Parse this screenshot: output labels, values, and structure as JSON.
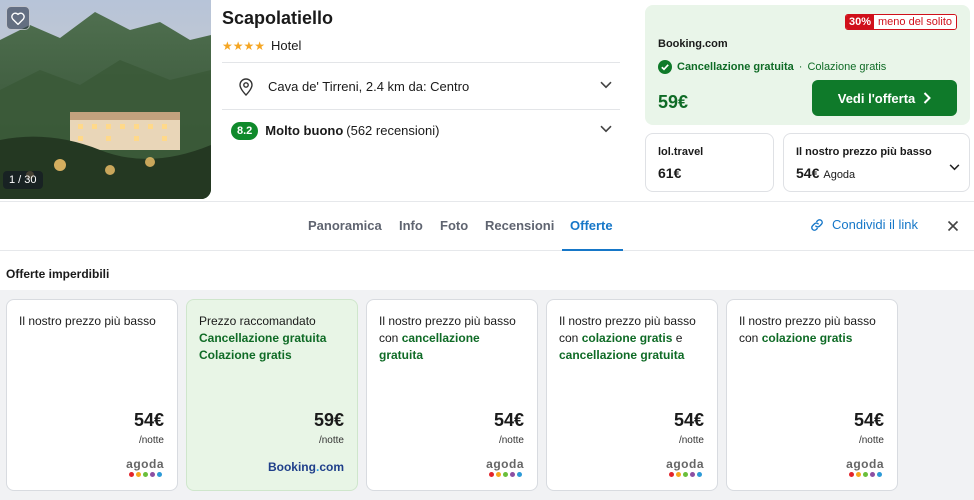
{
  "hotel": {
    "name": "Scapolatiello",
    "stars": 4,
    "type": "Hotel",
    "photo_counter": "1 / 30",
    "location": "Cava de' Tirreni, 2.4 km da: Centro",
    "score": "8.2",
    "score_label": "Molto buono",
    "reviews": "(562 recensioni)"
  },
  "main_offer": {
    "discount_pct": "30%",
    "discount_text": "meno del solito",
    "provider": "Booking.com",
    "free_cancellation": "Cancellazione gratuita",
    "separator": "·",
    "breakfast": "Colazione gratis",
    "price": "59€",
    "cta": "Vedi l'offerta"
  },
  "alt_offers": [
    {
      "provider": "lol.travel",
      "price": "61€",
      "provider_note": ""
    },
    {
      "provider": "Il nostro prezzo più basso",
      "price": "54€",
      "provider_note": "Agoda"
    }
  ],
  "tabs": [
    "Panoramica",
    "Info",
    "Foto",
    "Recensioni",
    "Offerte"
  ],
  "active_tab": "Offerte",
  "share_label": "Condividi il link",
  "deals_title": "Offerte imperdibili",
  "deals": [
    {
      "plain1": "Il nostro prezzo più basso",
      "green1": "",
      "plain2": "",
      "green2": "",
      "plain3": "",
      "price": "54€",
      "unit": "/notte",
      "provider": "agoda"
    },
    {
      "plain1": "Prezzo raccomandato",
      "green1": "Cancellazione gratuita",
      "plain2": "",
      "green2": "Colazione gratis",
      "plain3": "",
      "price": "59€",
      "unit": "/notte",
      "provider": "Booking.com"
    },
    {
      "plain1": "Il nostro prezzo più basso con ",
      "green1": "cancellazione gratuita",
      "plain2": "",
      "green2": "",
      "plain3": "",
      "price": "54€",
      "unit": "/notte",
      "provider": "agoda"
    },
    {
      "plain1": "Il nostro prezzo più basso con ",
      "green1": "colazione gratis",
      "plain2": " e ",
      "green2": "cancellazione gratuita",
      "plain3": "",
      "price": "54€",
      "unit": "/notte",
      "provider": "agoda"
    },
    {
      "plain1": "Il nostro prezzo più basso con ",
      "green1": "colazione gratis",
      "plain2": "",
      "green2": "",
      "plain3": "",
      "price": "54€",
      "unit": "/notte",
      "provider": "agoda"
    }
  ],
  "colors": {
    "accent_blue": "#1677c8",
    "cta_green": "#0f7a2a",
    "price_green": "#0f6b26",
    "discount_red": "#d0101a",
    "star_orange": "#f5a623"
  },
  "icons": {
    "favorite": "heart-icon",
    "location": "map-pin-icon",
    "check": "check-circle-icon",
    "share": "link-icon",
    "close": "close-icon",
    "expand": "chevron-down-icon",
    "cta_arrow": "chevron-right-icon"
  }
}
